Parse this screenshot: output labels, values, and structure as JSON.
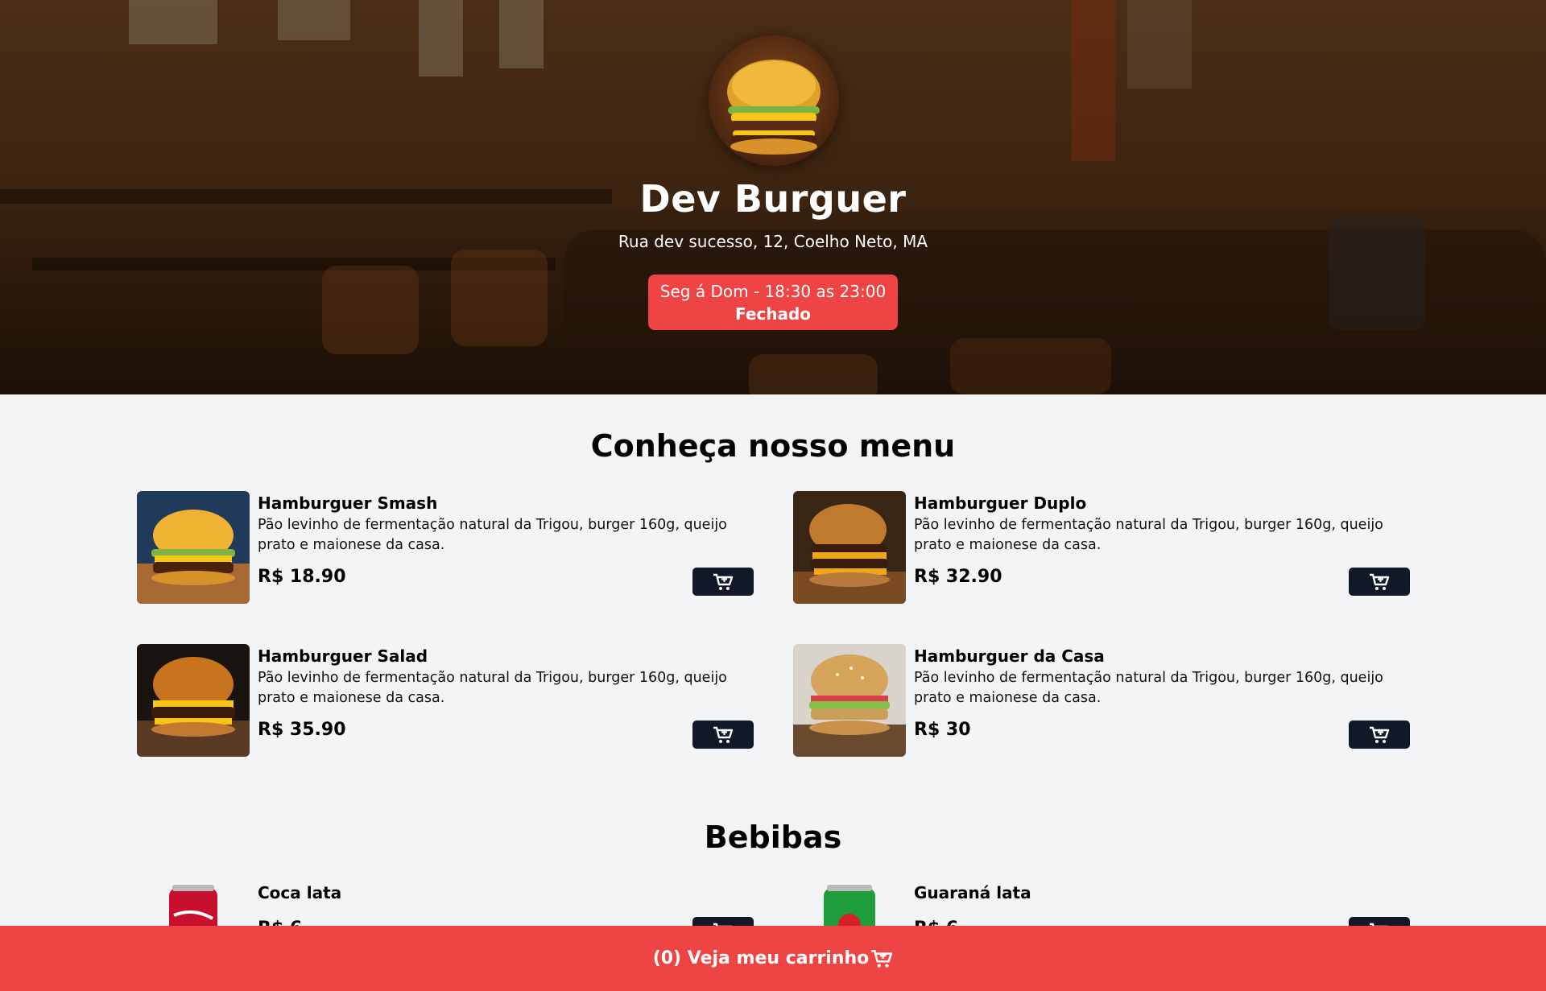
{
  "header": {
    "title": "Dev Burguer",
    "address": "Rua dev sucesso, 12, Coelho Neto, MA",
    "hours": "Seg á Dom - 18:30 as 23:00",
    "status": "Fechado"
  },
  "menu": {
    "title": "Conheça nosso menu",
    "items": [
      {
        "name": "Hamburguer Smash",
        "description": "Pão levinho de fermentação natural da Trigou, burger 160g, queijo prato e maionese da casa.",
        "price": "R$ 18.90"
      },
      {
        "name": "Hamburguer Duplo",
        "description": "Pão levinho de fermentação natural da Trigou, burger 160g, queijo prato e maionese da casa.",
        "price": "R$ 32.90"
      },
      {
        "name": "Hamburguer Salad",
        "description": "Pão levinho de fermentação natural da Trigou, burger 160g, queijo prato e maionese da casa.",
        "price": "R$ 35.90"
      },
      {
        "name": "Hamburguer da Casa",
        "description": "Pão levinho de fermentação natural da Trigou, burger 160g, queijo prato e maionese da casa.",
        "price": "R$ 30"
      }
    ]
  },
  "drinks": {
    "title": "Bebibas",
    "items": [
      {
        "name": "Coca lata",
        "price": "R$ 6"
      },
      {
        "name": "Guaraná lata",
        "price": "R$ 6"
      }
    ]
  },
  "cart": {
    "label": "(0) Veja meu carrinho"
  },
  "colors": {
    "accent": "#ef4444",
    "button": "#111827",
    "background": "#f3f4f6"
  }
}
